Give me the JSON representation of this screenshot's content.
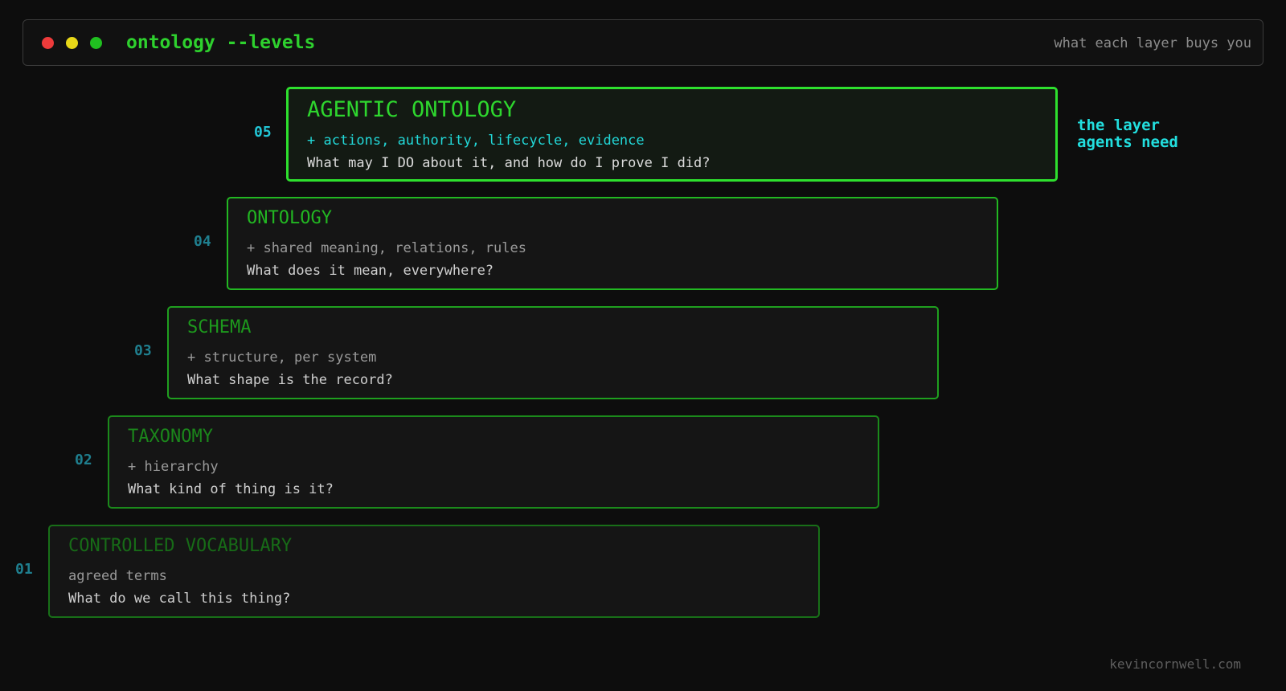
{
  "header": {
    "title": "ontology --levels",
    "subtitle": "what each layer buys you"
  },
  "levels": [
    {
      "number": "05",
      "title": "AGENTIC ONTOLOGY",
      "subtitle": "+ actions, authority, lifecycle, evidence",
      "question": "What may I DO about it, and how do I prove I did?"
    },
    {
      "number": "04",
      "title": "ONTOLOGY",
      "subtitle": "+ shared meaning, relations, rules",
      "question": "What does it mean, everywhere?"
    },
    {
      "number": "03",
      "title": "SCHEMA",
      "subtitle": "+ structure, per system",
      "question": "What shape is the record?"
    },
    {
      "number": "02",
      "title": "TAXONOMY",
      "subtitle": "+ hierarchy",
      "question": "What kind of thing is it?"
    },
    {
      "number": "01",
      "title": "CONTROLLED VOCABULARY",
      "subtitle": "agreed terms",
      "question": "What do we call this thing?"
    }
  ],
  "side_note": "the layer agents need",
  "footer": "kevincornwell.com",
  "colors": {
    "background": "#0d0d0d",
    "accent_green": "#2ed12e",
    "accent_cyan": "#22dede",
    "level_number": "#1f7f8f"
  }
}
